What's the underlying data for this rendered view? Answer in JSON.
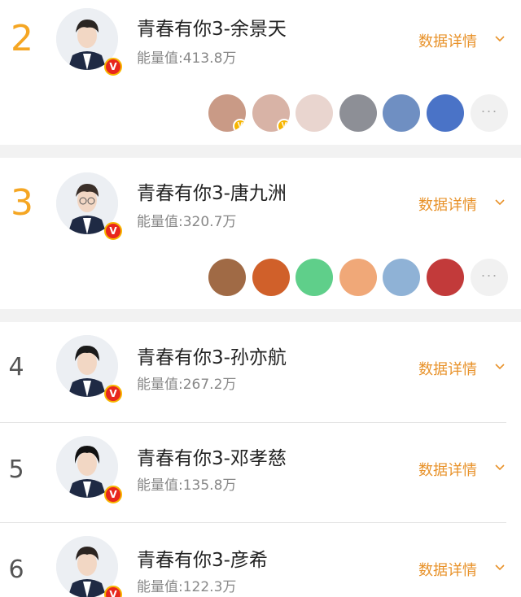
{
  "rows": [
    {
      "rank": "2",
      "name": "青春有你3-余景天",
      "energy": "能量值:413.8万",
      "detail_label": "数据详情",
      "avatar_icon": "person-avatar",
      "has_fans": true
    },
    {
      "rank": "3",
      "name": "青春有你3-唐九洲",
      "energy": "能量值:320.7万",
      "detail_label": "数据详情",
      "avatar_icon": "person-avatar",
      "has_fans": true
    },
    {
      "rank": "4",
      "name": "青春有你3-孙亦航",
      "energy": "能量值:267.2万",
      "detail_label": "数据详情",
      "avatar_icon": "person-avatar",
      "has_fans": false
    },
    {
      "rank": "5",
      "name": "青春有你3-邓孝慈",
      "energy": "能量值:135.8万",
      "detail_label": "数据详情",
      "avatar_icon": "person-avatar",
      "has_fans": false
    },
    {
      "rank": "6",
      "name": "青春有你3-彦希",
      "energy": "能量值:122.3万",
      "detail_label": "数据详情",
      "avatar_icon": "person-avatar",
      "has_fans": false
    }
  ],
  "verified_badge": "V",
  "more_label": "···",
  "colors": {
    "top_rank": "#f5a623",
    "detail_link": "#e8922a",
    "verified_red": "#e8271d",
    "verified_gold": "#f7b500"
  }
}
